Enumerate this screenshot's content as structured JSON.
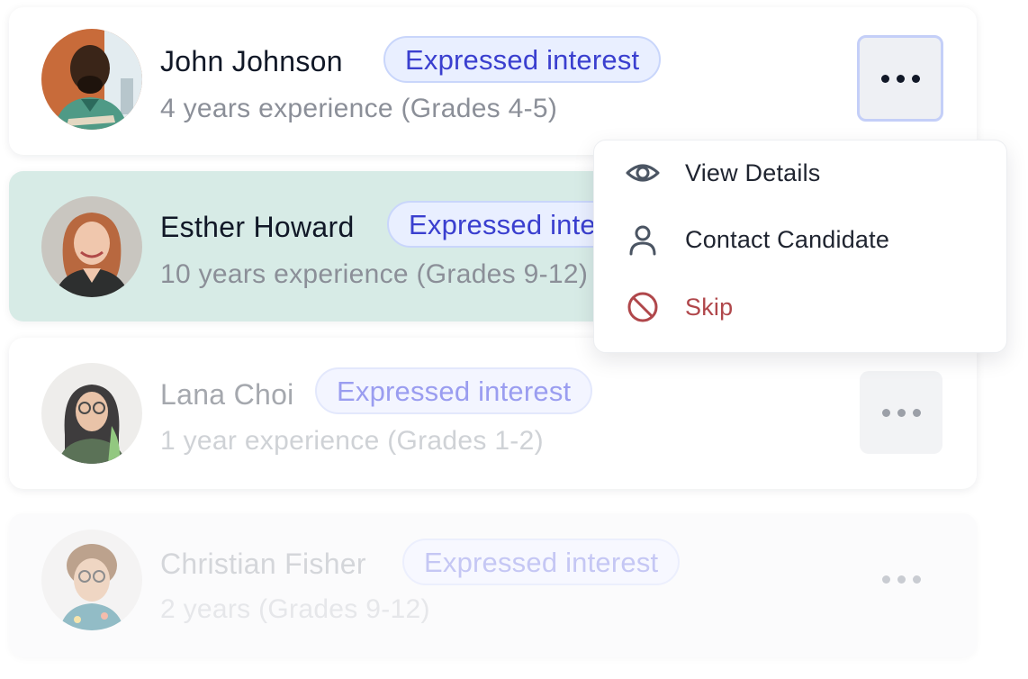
{
  "candidates": [
    {
      "name": "John Johnson",
      "status": "Expressed interest",
      "experience": "4 years experience (Grades 4-5)",
      "state": "active-menu-open"
    },
    {
      "name": "Esther Howard",
      "status": "Expressed interest",
      "experience": "10 years experience (Grades 9-12)",
      "state": "highlighted"
    },
    {
      "name": "Lana Choi",
      "status": "Expressed interest",
      "experience": "1 year experience (Grades 1-2)",
      "state": "dimmed"
    },
    {
      "name": "Christian Fisher",
      "status": "Expressed interest",
      "experience": "2 years (Grades 9-12)",
      "state": "faded"
    }
  ],
  "menu": {
    "items": [
      {
        "label": "View Details",
        "icon": "eye-icon"
      },
      {
        "label": "Contact Candidate",
        "icon": "user-icon"
      },
      {
        "label": "Skip",
        "icon": "ban-icon",
        "danger": true
      }
    ]
  },
  "colors": {
    "badge_text": "#3a3fcf",
    "badge_bg": "#e9efff",
    "highlight_row": "#d7ebe6",
    "danger": "#b0474b"
  }
}
